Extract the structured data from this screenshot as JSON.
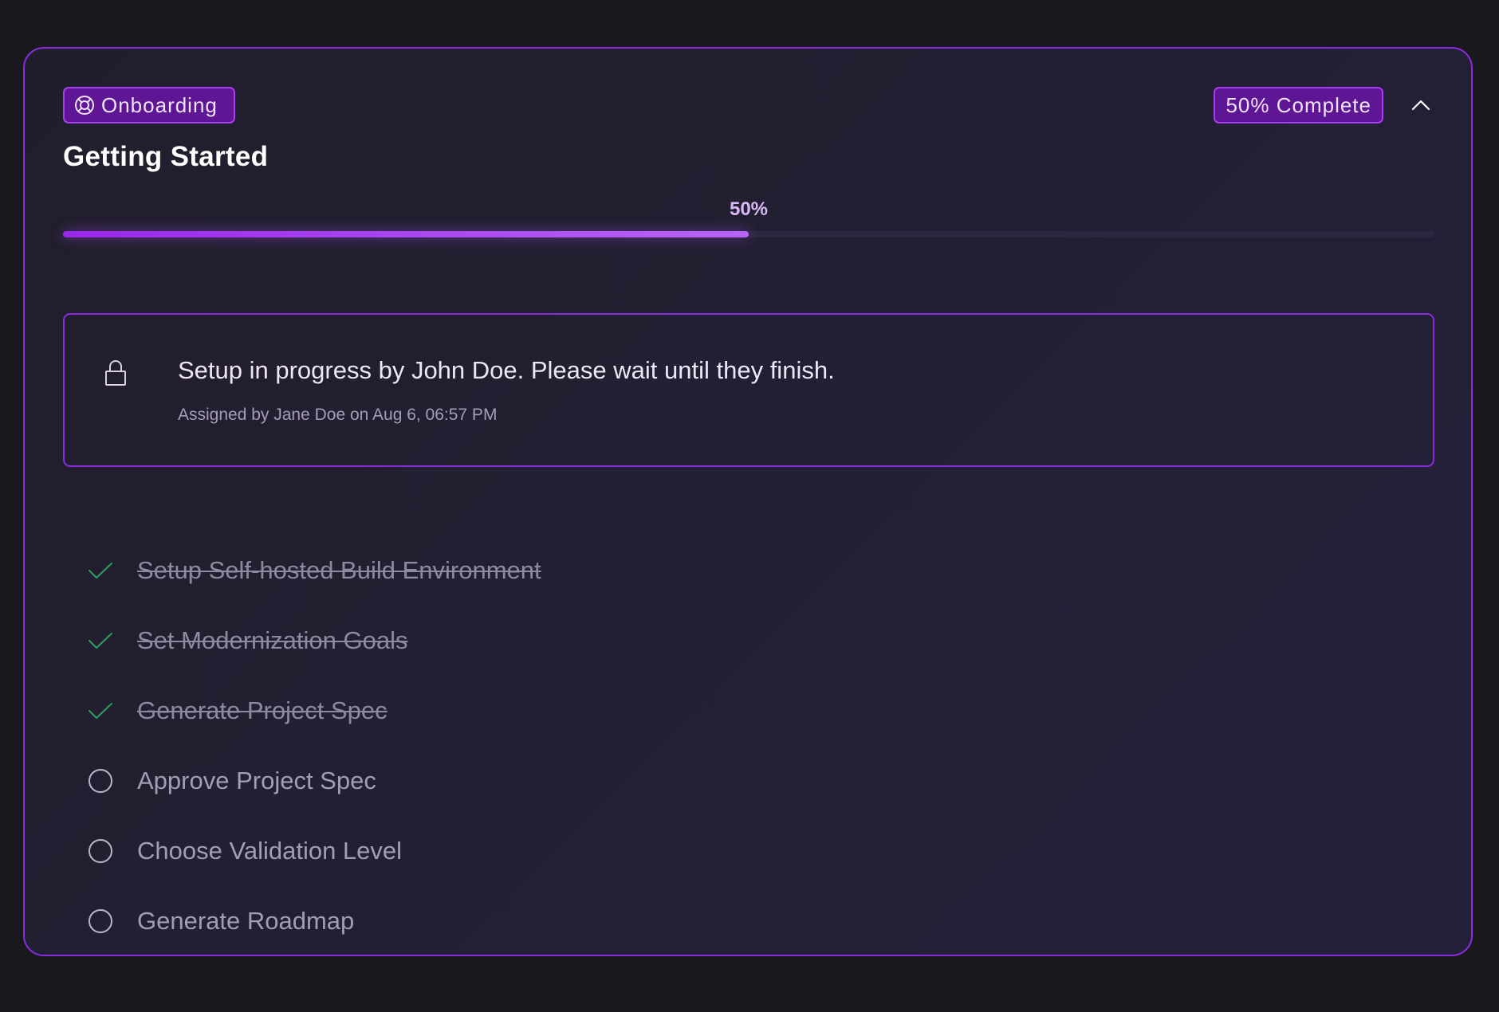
{
  "card": {
    "category_badge": "Onboarding",
    "category_icon": "lifebuoy-icon",
    "completion_badge": "50% Complete",
    "collapse_icon": "chevron-up-icon",
    "title": "Getting Started"
  },
  "progress": {
    "label": "50%",
    "value": 0.5
  },
  "notice": {
    "icon": "lock-icon",
    "message": "Setup in progress by John Doe. Please wait until they finish.",
    "meta": "Assigned by Jane Doe on Aug 6, 06:57 PM"
  },
  "tasks": [
    {
      "label": "Setup Self-hosted Build Environment",
      "status": "done"
    },
    {
      "label": "Set Modernization Goals",
      "status": "done"
    },
    {
      "label": "Generate Project Spec",
      "status": "done"
    },
    {
      "label": "Approve Project Spec",
      "status": "pending"
    },
    {
      "label": "Choose Validation Level",
      "status": "pending"
    },
    {
      "label": "Generate Roadmap",
      "status": "pending"
    }
  ],
  "colors": {
    "accent": "#8b2be0",
    "badge_bg": "#5f1694",
    "done_check": "#2f9e62",
    "background": "#19181d"
  }
}
